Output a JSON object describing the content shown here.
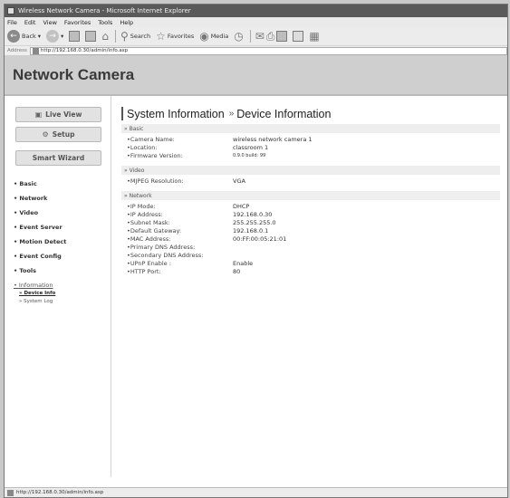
{
  "window": {
    "title": "Wireless Network Camera - Microsoft Internet Explorer"
  },
  "menu": [
    "File",
    "Edit",
    "View",
    "Favorites",
    "Tools",
    "Help"
  ],
  "toolbar": {
    "back_label": "Back",
    "search_label": "Search",
    "favorites_label": "Favorites",
    "media_label": "Media"
  },
  "address": {
    "label": "Address",
    "url": "http://192.168.0.30/admin/info.asp"
  },
  "banner": {
    "title": "Network Camera"
  },
  "sidebar": {
    "live_view": "Live View",
    "setup": "Setup",
    "smart_wizard": "Smart Wizard",
    "nav": [
      "• Basic",
      "• Network",
      "• Video",
      "• Event Server",
      "• Motion Detect",
      "• Event Config",
      "• Tools",
      "• Information"
    ],
    "subnav": [
      "» Device Info",
      "» System Log"
    ]
  },
  "main": {
    "heading": "System Information",
    "subheading": "Device Information",
    "sections": [
      {
        "title": "» Basic",
        "rows": [
          {
            "label": "•Camera Name:",
            "value": "wireless network camera 1"
          },
          {
            "label": "•Location:",
            "value": "classroom 1"
          },
          {
            "label": "•Firmware Version:",
            "value": "0.9.0 build: 99"
          }
        ]
      },
      {
        "title": "» Video",
        "rows": [
          {
            "label": "•MJPEG Resolution:",
            "value": "VGA"
          }
        ]
      },
      {
        "title": "» Network",
        "rows": [
          {
            "label": "•IP Mode:",
            "value": "DHCP"
          },
          {
            "label": "•IP Address:",
            "value": "192.168.0.30"
          },
          {
            "label": "•Subnet Mask:",
            "value": "255.255.255.0"
          },
          {
            "label": "•Default Gateway:",
            "value": "192.168.0.1"
          },
          {
            "label": "•MAC Address:",
            "value": "00:FF:00:05:21:01"
          },
          {
            "label": "•Primary DNS Address:",
            "value": ""
          },
          {
            "label": "•Secondary DNS Address:",
            "value": ""
          },
          {
            "label": "•UPnP Enable :",
            "value": "Enable"
          },
          {
            "label": "•HTTP Port:",
            "value": "80"
          }
        ]
      }
    ]
  },
  "status": {
    "text": "http://192.168.0.30/admin/info.asp"
  }
}
